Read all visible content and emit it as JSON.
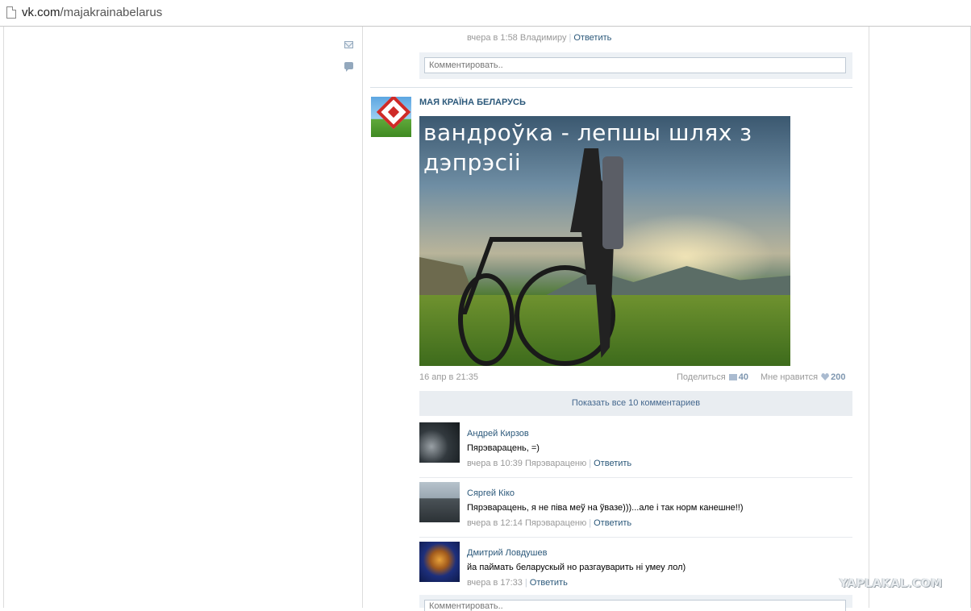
{
  "browser": {
    "url_host": "vk.com",
    "url_path": "/majakrainabelarus"
  },
  "prev_post": {
    "meta_time": "вчера в 1:58 Владимиру",
    "reply_label": "Ответить",
    "comment_placeholder": "Комментировать.."
  },
  "post": {
    "group_name": "МАЯ КРАЇНА БЕЛАРУСЬ",
    "image_caption": "вандроўка - лепшы шлях з дэпрэсіі",
    "date": "16 апр в 21:35",
    "share_label": "Поделиться",
    "share_count": "40",
    "like_label": "Мне нравится",
    "like_count": "200",
    "show_all_comments": "Показать все 10 комментариев"
  },
  "comments": [
    {
      "author": "Андрей Кирзов",
      "text": "Пярэварацень, =)",
      "time": "вчера в 10:39 Пярэвараценю",
      "reply": "Ответить"
    },
    {
      "author": "Сяргей Кіко",
      "text": "Пярэварацень, я не піва меў на ўвазе)))...але і так норм канешне!!)",
      "time": "вчера в 12:14 Пярэвараценю",
      "reply": "Ответить"
    },
    {
      "author": "Дмитрий Ловдушев",
      "text": "йа паймать беларускый но разгауварить ні умеу лол)",
      "time": "вчера в 17:33",
      "reply": "Ответить"
    }
  ],
  "bottom_comment_placeholder": "Комментировать..",
  "watermark": "YAPLAKAL.COM"
}
